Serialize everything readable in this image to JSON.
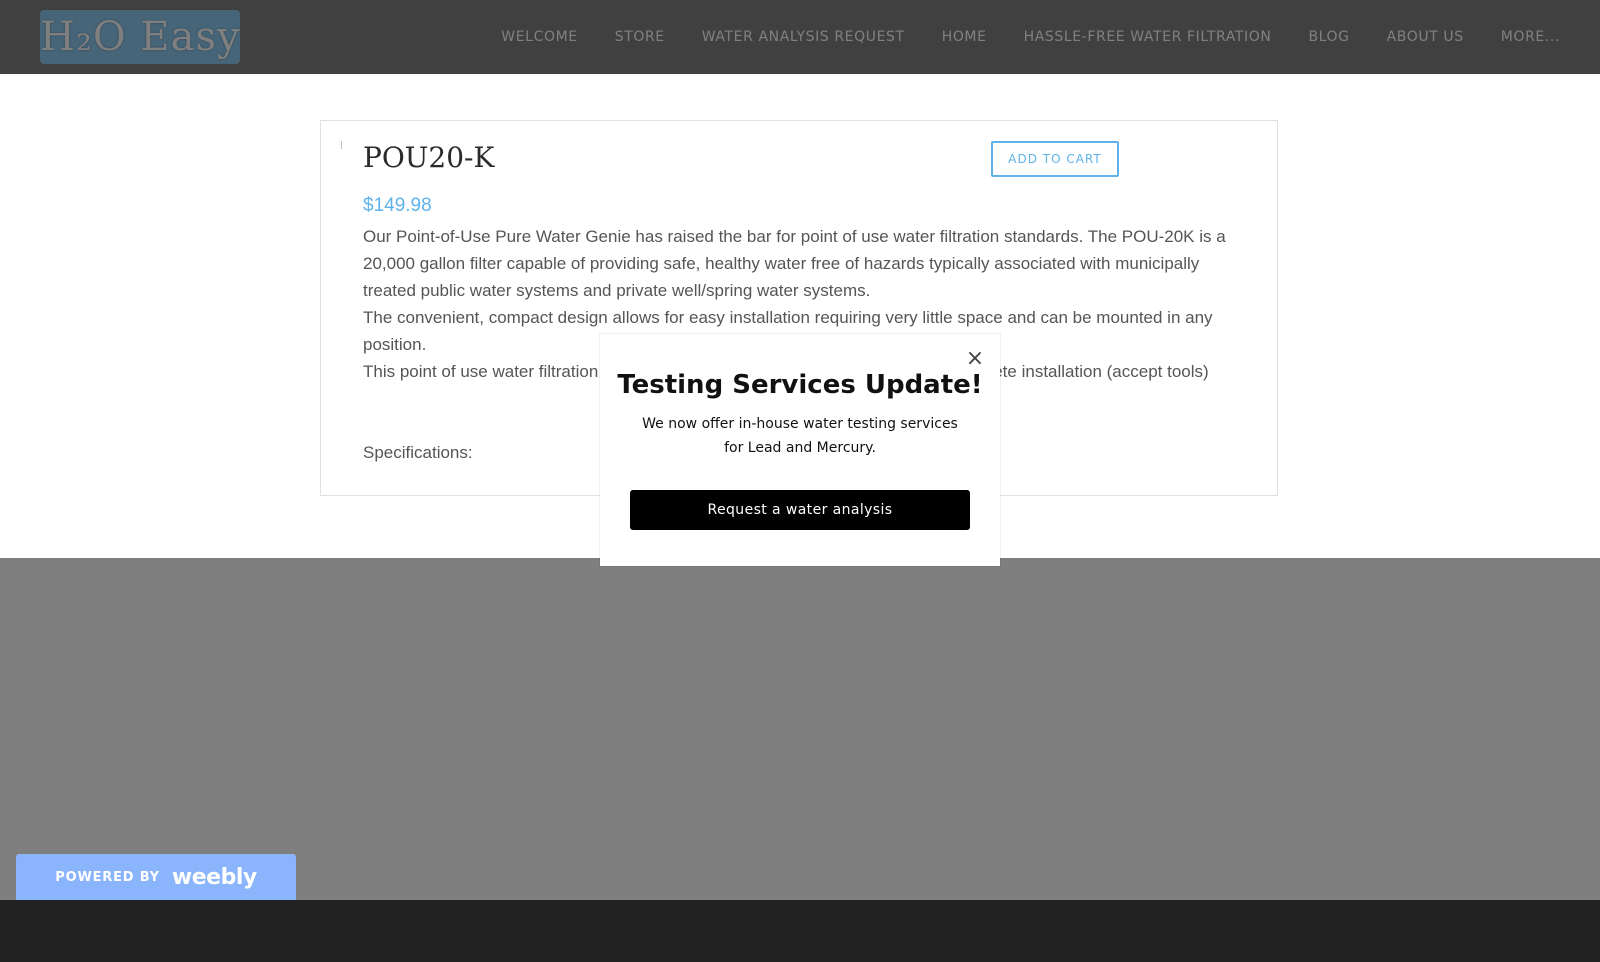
{
  "header": {
    "logo_text": "H₂O Easy",
    "nav": [
      {
        "label": "WELCOME"
      },
      {
        "label": "STORE"
      },
      {
        "label": "WATER ANALYSIS REQUEST"
      },
      {
        "label": "HOME"
      },
      {
        "label": "HASSLE-FREE WATER FILTRATION"
      },
      {
        "label": "BLOG"
      },
      {
        "label": "ABOUT US"
      },
      {
        "label": "MORE..."
      }
    ]
  },
  "product": {
    "title": "POU20-K",
    "add_to_cart_label": "ADD TO CART",
    "price": "$149.98",
    "description": [
      "Our Point-of-Use Pure Water Genie has raised the bar for point of use water filtration standards. The POU-20K is a 20,000 gallon filter capable of providing safe, healthy water free of hazards typically associated with municipally treated public water systems and private well/spring water systems.",
      "The convenient, compact design allows for easy installation requiring very little space and can be mounted in any position.",
      "This point of use water filtration system comes with everything you need for a complete installation (accept tools)"
    ],
    "specifications_label": "Specifications:"
  },
  "modal": {
    "close_glyph": "×",
    "heading": "Testing Services Update!",
    "text": "We now offer in-house water testing services for Lead and Mercury.",
    "button_label": "Request a water analysis"
  },
  "footer": {
    "powered_by": "POWERED BY",
    "weebly": "weebly"
  },
  "colors": {
    "accent": "#5fb3eb",
    "header_dimmed": "#808080",
    "footer_bar": "#222222",
    "badge": "#8ab4fb"
  }
}
